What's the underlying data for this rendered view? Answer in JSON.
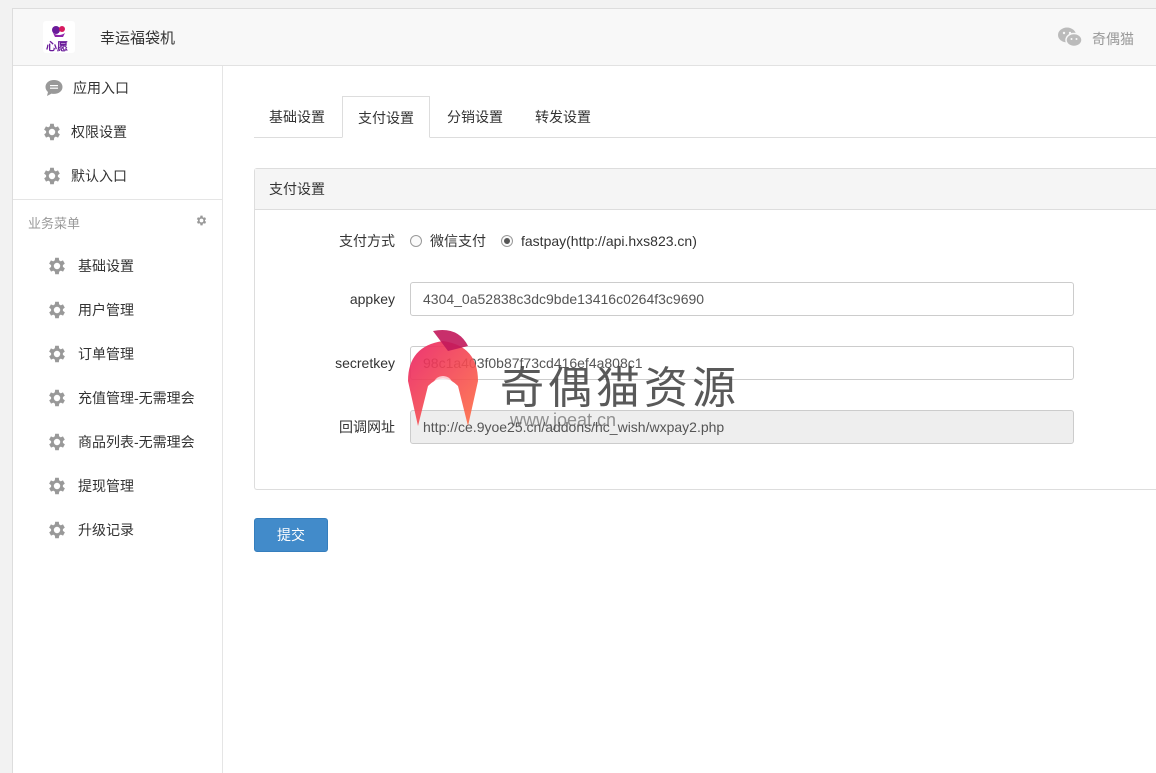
{
  "header": {
    "logo_text": "心愿",
    "app_title": "幸运福袋机",
    "account_name": "奇偶猫"
  },
  "sidebar": {
    "top_items": [
      {
        "label": "应用入口",
        "icon": "chat-bubble-icon"
      },
      {
        "label": "权限设置",
        "icon": "gear-icon"
      },
      {
        "label": "默认入口",
        "icon": "gear-icon"
      }
    ],
    "group_title": "业务菜单",
    "business_items": [
      {
        "label": "基础设置"
      },
      {
        "label": "用户管理"
      },
      {
        "label": "订单管理"
      },
      {
        "label": "充值管理-无需理会"
      },
      {
        "label": "商品列表-无需理会"
      },
      {
        "label": "提现管理"
      },
      {
        "label": "升级记录"
      }
    ]
  },
  "tabs": [
    {
      "label": "基础设置",
      "active": false
    },
    {
      "label": "支付设置",
      "active": true
    },
    {
      "label": "分销设置",
      "active": false
    },
    {
      "label": "转发设置",
      "active": false
    }
  ],
  "panel": {
    "title": "支付设置",
    "pay_method_label": "支付方式",
    "pay_options": [
      {
        "label": "微信支付",
        "checked": false
      },
      {
        "label": "fastpay(http://api.hxs823.cn)",
        "checked": true
      }
    ],
    "appkey_label": "appkey",
    "appkey_value": "4304_0a52838c3dc9bde13416c0264f3c9690",
    "secretkey_label": "secretkey",
    "secretkey_value": "98c1a403f0b87f73cd416ef4a808c1",
    "callback_label": "回调网址",
    "callback_value": "http://ce.9yoe25.cn/addons/hc_wish/wxpay2.php"
  },
  "submit_label": "提交",
  "watermark": {
    "text": "奇偶猫资源",
    "sub": "www.joeat.cn"
  },
  "colors": {
    "primary": "#428bca",
    "watermark_logo": "#c2185b"
  }
}
